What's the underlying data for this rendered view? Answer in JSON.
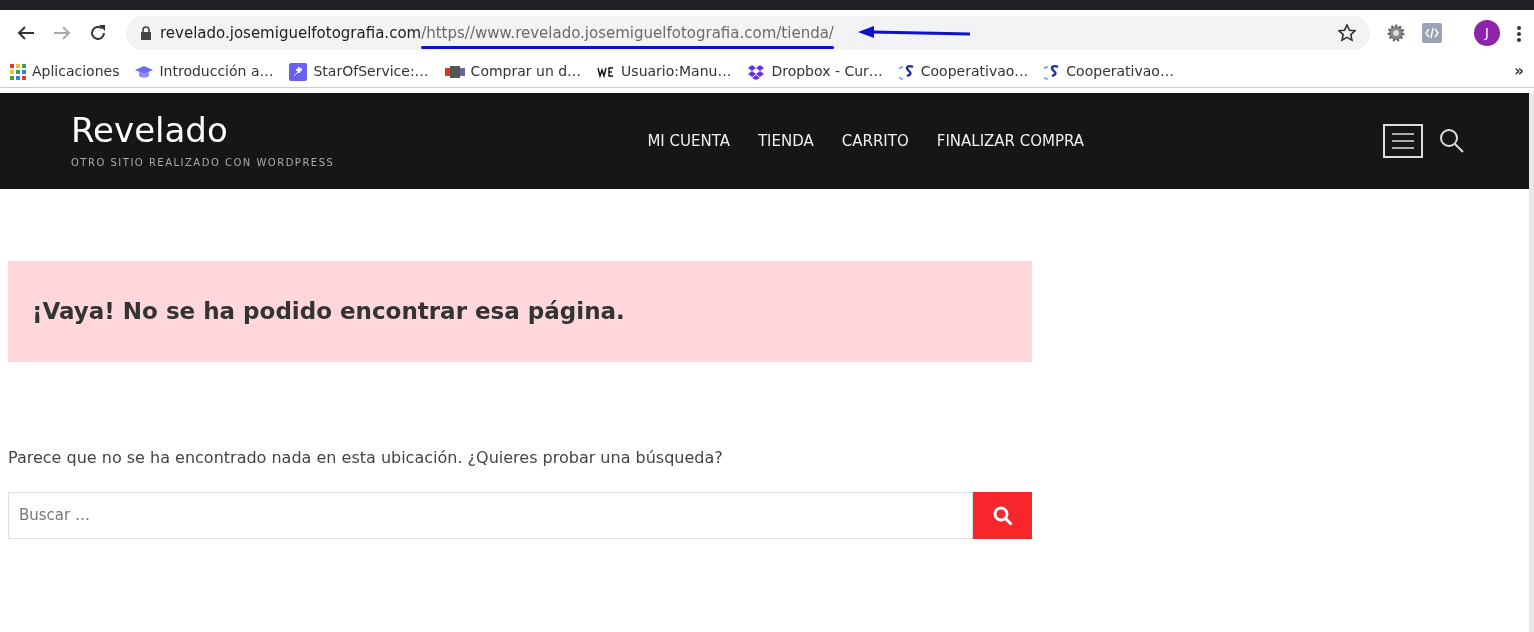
{
  "browser": {
    "url_host": "revelado.josemiguelfotografia.com",
    "url_path": "/https//www.revelado.josemiguelfotografia.com/tienda/",
    "profile_initial": "J",
    "bookmarks": [
      {
        "kind": "grid",
        "label": "Aplicaciones"
      },
      {
        "kind": "cap",
        "label": "Introducción a…"
      },
      {
        "kind": "sparkle",
        "label": "StarOfService:…"
      },
      {
        "kind": "emblem",
        "label": "Comprar un d…"
      },
      {
        "kind": "we",
        "label": "Usuario:Manu…"
      },
      {
        "kind": "dropbox",
        "label": "Dropbox - Cur…"
      },
      {
        "kind": "s",
        "label": "Cooperativao…"
      },
      {
        "kind": "s",
        "label": "Cooperativao…"
      }
    ],
    "overflow": "»"
  },
  "site": {
    "title": "Revelado",
    "tagline": "OTRO SITIO REALIZADO CON WORDPRESS",
    "menu": [
      "MI CUENTA",
      "TIENDA",
      "CARRITO",
      "FINALIZAR COMPRA"
    ]
  },
  "content": {
    "alert": "¡Vaya! No se ha podido encontrar esa página.",
    "message": "Parece que no se ha encontrado nada en esta ubicación. ¿Quieres probar una búsqueda?",
    "search": {
      "placeholder": "Buscar …"
    }
  }
}
